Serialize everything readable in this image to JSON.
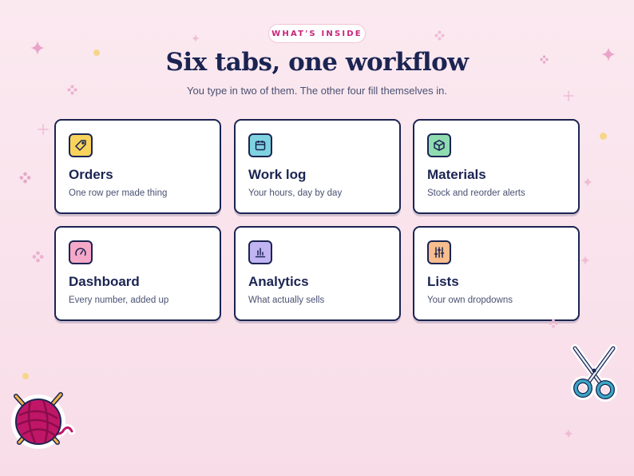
{
  "header": {
    "badge": "WHAT'S INSIDE",
    "title": "Six tabs, one workflow",
    "subtitle": "You type in two of them. The other four fill themselves in."
  },
  "colors": {
    "orders": "#f8d35c",
    "worklog": "#7fd3e0",
    "materials": "#8fdcb0",
    "dashboard": "#f6a8c8",
    "analytics": "#c1b4f2",
    "lists": "#f7bd8d"
  },
  "cards": [
    {
      "title": "Orders",
      "desc": "One row per made thing",
      "icon": "tag-icon"
    },
    {
      "title": "Work log",
      "desc": "Your hours, day by day",
      "icon": "calendar-icon"
    },
    {
      "title": "Materials",
      "desc": "Stock and reorder alerts",
      "icon": "box-icon"
    },
    {
      "title": "Dashboard",
      "desc": "Every number, added up",
      "icon": "gauge-icon"
    },
    {
      "title": "Analytics",
      "desc": "What actually sells",
      "icon": "bar-chart-icon"
    },
    {
      "title": "Lists",
      "desc": "Your own dropdowns",
      "icon": "sliders-icon"
    }
  ]
}
